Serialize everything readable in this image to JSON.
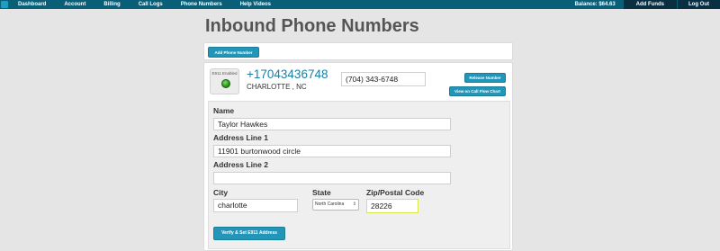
{
  "nav": {
    "links": [
      {
        "label": "Dashboard"
      },
      {
        "label": "Account"
      },
      {
        "label": "Billing"
      },
      {
        "label": "Call Logs"
      },
      {
        "label": "Phone Numbers"
      },
      {
        "label": "Help Videos"
      }
    ],
    "balance": "Balance: $64.63",
    "add_funds": "Add Funds",
    "log_out": "Log Out"
  },
  "page": {
    "title": "Inbound Phone Numbers",
    "add_button": "Add Phone Number"
  },
  "number": {
    "e911_label": "E911 Enabled",
    "e911_status_color": "#2f9a1c",
    "phone": "+17043436748",
    "city_state": "CHARLOTTE , NC",
    "formatted": "(704) 343-6748",
    "release_button": "Release Number",
    "view_flow_button": "View on Call Flow Chart"
  },
  "form": {
    "name_label": "Name",
    "name_value": "Taylor Hawkes",
    "addr1_label": "Address Line 1",
    "addr1_value": "11901 burtonwood circle",
    "addr2_label": "Address Line 2",
    "addr2_value": "",
    "city_label": "City",
    "city_value": "charlotte",
    "state_label": "State",
    "state_value": "North Carolina",
    "zip_label": "Zip/Postal Code",
    "zip_value": "28226",
    "submit_button": "Verify & Set E911 Address"
  },
  "colors": {
    "nav_bg": "#0a5f78",
    "button": "#2196b8",
    "link": "#1a7fa3",
    "focus": "#d8e84b"
  }
}
